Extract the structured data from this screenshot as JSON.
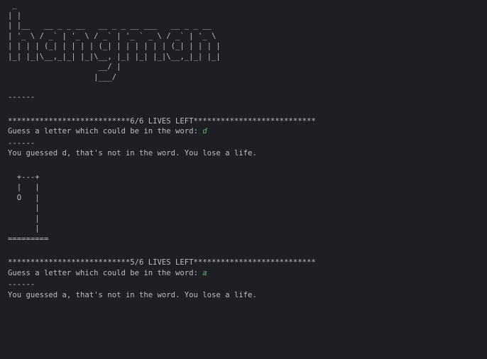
{
  "banner": [
    " _",
    "| |",
    "| |__   __ _ _ __   __ _ _ __ ___   __ _ _ __",
    "| '_ \\ / _` | '_ \\ / _` | '_ ` _ \\ / _` | '_ \\",
    "| | | | (_| | | | | (_| | | | | | | (_| | | | |",
    "|_| |_|\\__,_|_| |_|\\__, |_| |_| |_|\\__,_|_| |_|",
    "                    __/ |",
    "                   |___/"
  ],
  "separator_short": "------",
  "rounds": [
    {
      "lives_banner": "***************************6/6 LIVES LEFT***************************",
      "prompt": "Guess a letter which could be in the word: ",
      "guess": "d",
      "separator": "------",
      "result": "You guessed d, that's not in the word. You lose a life."
    },
    {
      "lives_banner": "***************************5/6 LIVES LEFT***************************",
      "prompt": "Guess a letter which could be in the word: ",
      "guess": "a",
      "separator": "------",
      "result": "You guessed a, that's not in the word. You lose a life."
    }
  ],
  "gallows": [
    "  +---+",
    "  |   |",
    "  O   |",
    "      |",
    "      |",
    "      |",
    "========="
  ]
}
